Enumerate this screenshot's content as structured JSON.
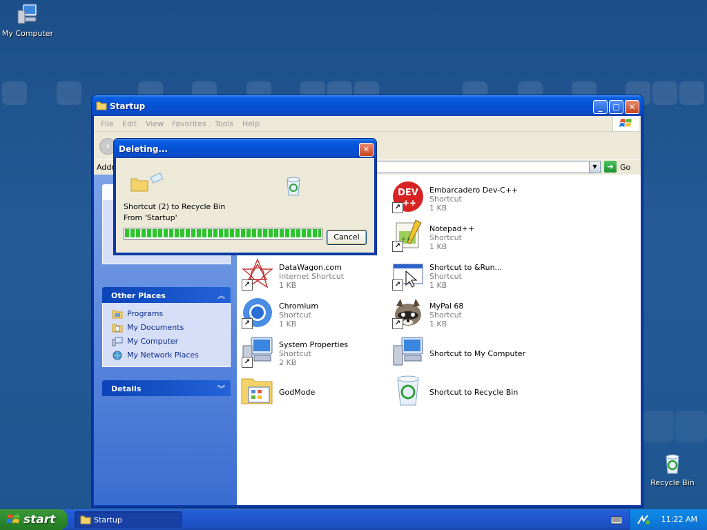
{
  "desktop": {
    "icons": [
      {
        "label": "My Computer",
        "icon": "my-computer-icon"
      },
      {
        "label": "Recycle Bin",
        "icon": "recycle-bin-icon"
      }
    ]
  },
  "window": {
    "title": "Startup",
    "menu": [
      "File",
      "Edit",
      "View",
      "Favorites",
      "Tools",
      "Help"
    ],
    "address_label": "Addre",
    "go_label": "Go"
  },
  "left_pane": {
    "other_places": {
      "title": "Other Places",
      "links": [
        "Programs",
        "My Documents",
        "My Computer",
        "My Network Places"
      ]
    },
    "details": {
      "title": "Details"
    }
  },
  "items": [
    {
      "name": "Embarcadero Dev-C++",
      "type": "Shortcut",
      "size": "1 KB",
      "icon": "devcpp-icon"
    },
    {
      "name": "Notepad++",
      "type": "Shortcut",
      "size": "1 KB",
      "icon": "notepad-plus-plus-icon"
    },
    {
      "name": "DataWagon.com",
      "type": "Internet Shortcut",
      "size": "1 KB",
      "icon": "datawagon-icon"
    },
    {
      "name": "Shortcut to &Run...",
      "type": "Shortcut",
      "size": "1 KB",
      "icon": "run-dialog-icon"
    },
    {
      "name": "Chromium",
      "type": "Shortcut",
      "size": "1 KB",
      "icon": "chromium-icon"
    },
    {
      "name": "MyPal 68",
      "type": "Shortcut",
      "size": "1 KB",
      "icon": "mypal-icon"
    },
    {
      "name": "System Properties",
      "type": "Shortcut",
      "size": "2 KB",
      "icon": "system-properties-icon"
    },
    {
      "name": "Shortcut to My Computer",
      "icon": "my-computer-icon"
    },
    {
      "name": "GodMode",
      "icon": "folder-icon"
    },
    {
      "name": "Shortcut to Recycle Bin",
      "icon": "recycle-bin-icon"
    }
  ],
  "dialog": {
    "title": "Deleting...",
    "line1": "Shortcut (2) to Recycle Bin",
    "line2": "From 'Startup'",
    "progress": 1.0,
    "cancel_label": "Cancel"
  },
  "taskbar": {
    "start_label": "start",
    "task_label": "Startup",
    "clock": "11:22 AM"
  }
}
